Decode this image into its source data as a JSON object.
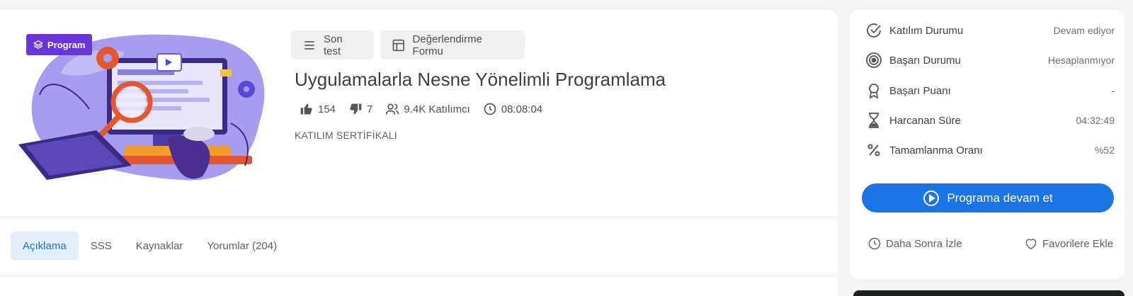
{
  "badge": {
    "label": "Program"
  },
  "buttons": {
    "son_test": "Son test",
    "degerlendirme": "Değerlendirme Formu"
  },
  "course": {
    "title": "Uygulamalarla Nesne Yönelimli Programlama",
    "likes": "154",
    "dislikes": "7",
    "participants": "9.4K Katılımcı",
    "duration": "08:08:04",
    "certificate": "KATILIM SERTİFİKALI"
  },
  "tabs": [
    "Açıklama",
    "SSS",
    "Kaynaklar",
    "Yorumlar (204)"
  ],
  "side": {
    "rows": [
      {
        "label": "Katılım Durumu",
        "value": "Devam ediyor",
        "icon": "check-circle-icon"
      },
      {
        "label": "Başarı Durumu",
        "value": "Hesaplanmıyor",
        "icon": "target-icon"
      },
      {
        "label": "Başarı Puanı",
        "value": "-",
        "icon": "award-icon"
      },
      {
        "label": "Harcanan Süre",
        "value": "04:32:49",
        "icon": "hourglass-icon"
      },
      {
        "label": "Tamamlanma Oranı",
        "value": "%52",
        "icon": "percent-icon"
      }
    ],
    "continue_label": "Programa devam et",
    "watch_later": "Daha Sonra İzle",
    "add_favorite": "Favorilere Ekle"
  },
  "colors": {
    "accent": "#1b74e4",
    "badge": "#6a35d8",
    "active_tab_bg": "#e3eefb"
  }
}
